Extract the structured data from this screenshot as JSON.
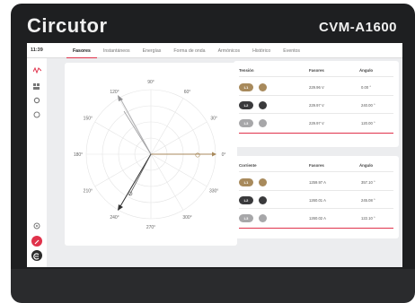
{
  "brand": "Circutor",
  "model": "CVM-A1600",
  "time": "11:39",
  "tabs": [
    "Fasores",
    "Instantáneos",
    "Energías",
    "Forma de onda",
    "Armónicos",
    "Histórico",
    "Eventos"
  ],
  "active_tab": "Fasores",
  "phasor_labels": [
    "90°",
    "60°",
    "30°",
    "0°",
    "330°",
    "300°",
    "270°",
    "240°",
    "210°",
    "180°",
    "150°",
    "120°"
  ],
  "colors": {
    "accent": "#e0324b",
    "L1": "#a88a5c",
    "L2": "#3a3a3c",
    "L3": "#a7a7a9"
  },
  "voltage_table": {
    "headers": [
      "Tensión",
      "Fasores",
      "Ángulo"
    ],
    "rows": [
      {
        "phase": "L1",
        "value": "229.96 V",
        "angle": "0.00 °"
      },
      {
        "phase": "L2",
        "value": "229.97 V",
        "angle": "240.00 °"
      },
      {
        "phase": "L3",
        "value": "229.97 V",
        "angle": "120.00 °"
      }
    ]
  },
  "current_table": {
    "headers": [
      "Corriente",
      "Fasores",
      "Ángulo"
    ],
    "rows": [
      {
        "phase": "L1",
        "value": "1259.97 A",
        "angle": "357.10 °"
      },
      {
        "phase": "L2",
        "value": "1260.01 A",
        "angle": "245.08 °"
      },
      {
        "phase": "L3",
        "value": "1260.02 A",
        "angle": "122.10 °"
      }
    ]
  }
}
